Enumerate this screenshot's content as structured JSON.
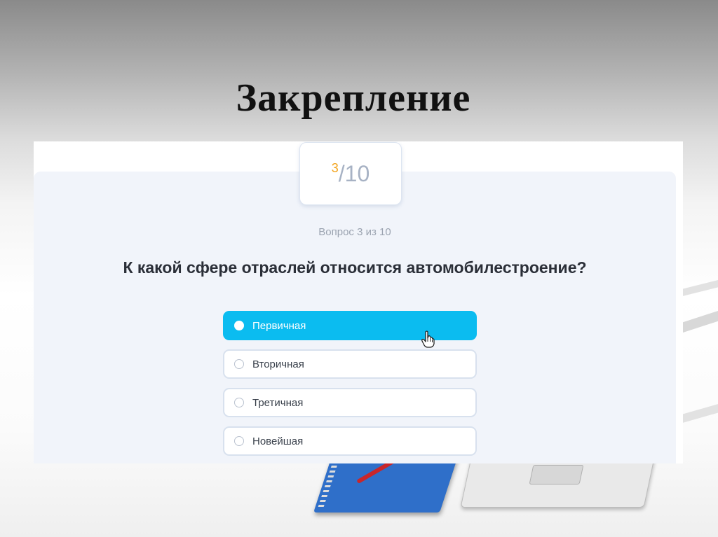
{
  "slide": {
    "title": "Закрепление"
  },
  "quiz": {
    "counter": {
      "current": "3",
      "separator": "/",
      "total": "10"
    },
    "progress_label": "Вопрос 3 из 10",
    "question": "К какой сфере отраслей относится автомобилестроение?",
    "options": [
      {
        "label": "Первичная",
        "selected": true
      },
      {
        "label": "Вторичная",
        "selected": false
      },
      {
        "label": "Третичная",
        "selected": false
      },
      {
        "label": "Новейшая",
        "selected": false
      }
    ]
  },
  "colors": {
    "accent": "#0bbcf0",
    "counter_current": "#f2a31b",
    "card_background": "#f1f4fa"
  },
  "icons": [
    "hand-pointer-icon",
    "radio-button-icon"
  ]
}
